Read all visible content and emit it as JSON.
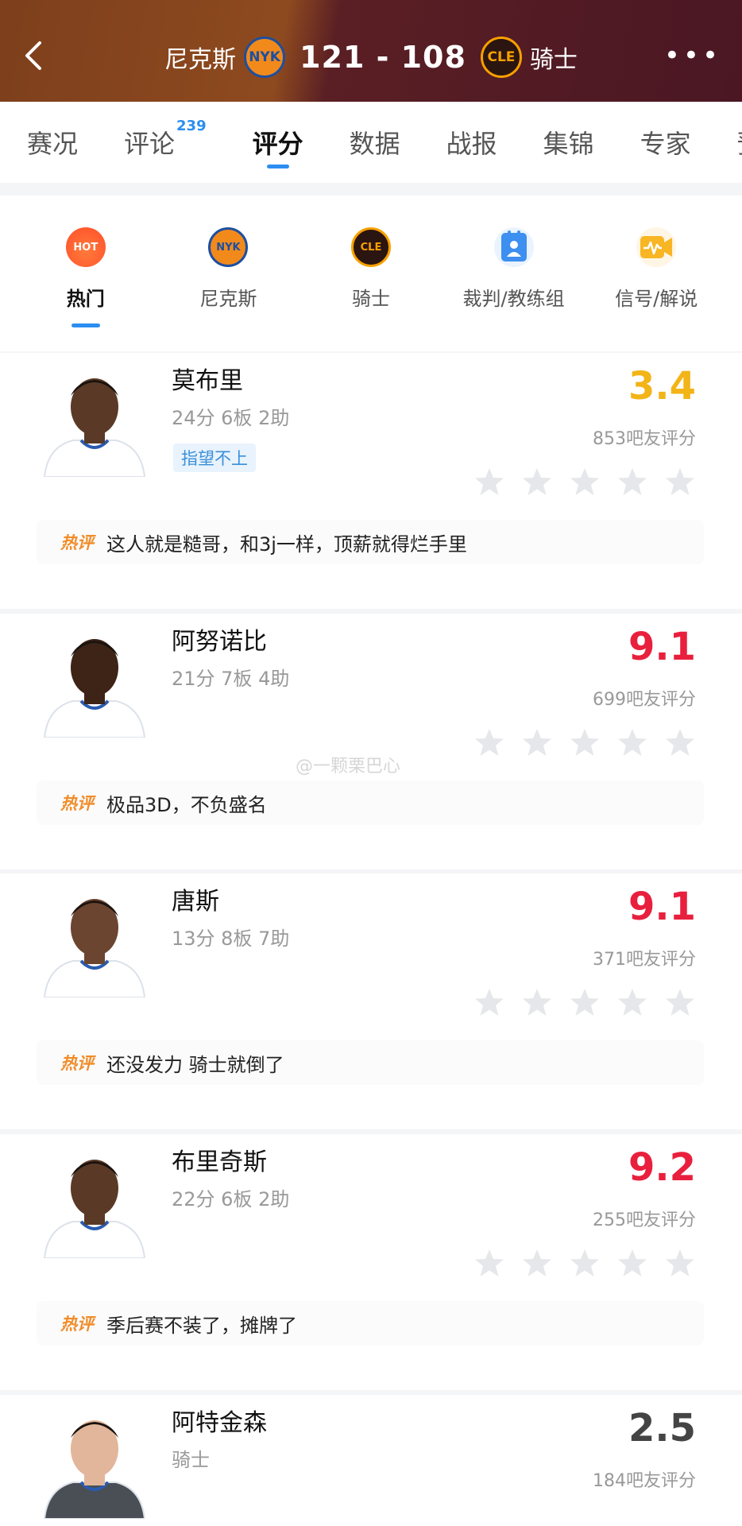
{
  "header": {
    "home_team": "尼克斯",
    "home_logo": "NYK",
    "score": "121 - 108",
    "away_logo": "CLE",
    "away_team": "骑士",
    "more": "•••"
  },
  "tabs": [
    {
      "label": "赛况"
    },
    {
      "label": "评论",
      "badge": "239"
    },
    {
      "label": "评分"
    },
    {
      "label": "数据"
    },
    {
      "label": "战报"
    },
    {
      "label": "集锦"
    },
    {
      "label": "专家"
    },
    {
      "label": "预"
    }
  ],
  "categories": [
    {
      "label": "热门",
      "icon_text": "HOT"
    },
    {
      "label": "尼克斯",
      "icon_text": "NYK"
    },
    {
      "label": "骑士",
      "icon_text": "CLE"
    },
    {
      "label": "裁判/教练组"
    },
    {
      "label": "信号/解说"
    }
  ],
  "players": [
    {
      "name": "莫布里",
      "stats": "24分 6板 2助",
      "tag": "指望不上",
      "rating": "3.4",
      "rating_color": "#f2b417",
      "count": "853吧友评分",
      "hot_label": "热评",
      "comment": "这人就是糙哥，和3j一样，顶薪就得烂手里"
    },
    {
      "name": "阿努诺比",
      "stats": "21分 7板 4助",
      "rating": "9.1",
      "rating_color": "#e8203d",
      "count": "699吧友评分",
      "hot_label": "热评",
      "comment": "极品3D，不负盛名"
    },
    {
      "name": "唐斯",
      "stats": "13分 8板 7助",
      "rating": "9.1",
      "rating_color": "#e8203d",
      "count": "371吧友评分",
      "hot_label": "热评",
      "comment": "还没发力 骑士就倒了"
    },
    {
      "name": "布里奇斯",
      "stats": "22分 6板 2助",
      "rating": "9.2",
      "rating_color": "#e8203d",
      "count": "255吧友评分",
      "hot_label": "热评",
      "comment": "季后赛不装了，摊牌了"
    },
    {
      "name": "阿特金森",
      "stats": "骑士",
      "rating": "2.5",
      "rating_color": "#444444",
      "count": "184吧友评分"
    }
  ],
  "watermark": "@一颗栗巴心",
  "colors": {
    "accent": "#2b8ef0",
    "hot_label": "#f08d2a",
    "rating_high": "#e8203d",
    "rating_low": "#f2b417"
  }
}
